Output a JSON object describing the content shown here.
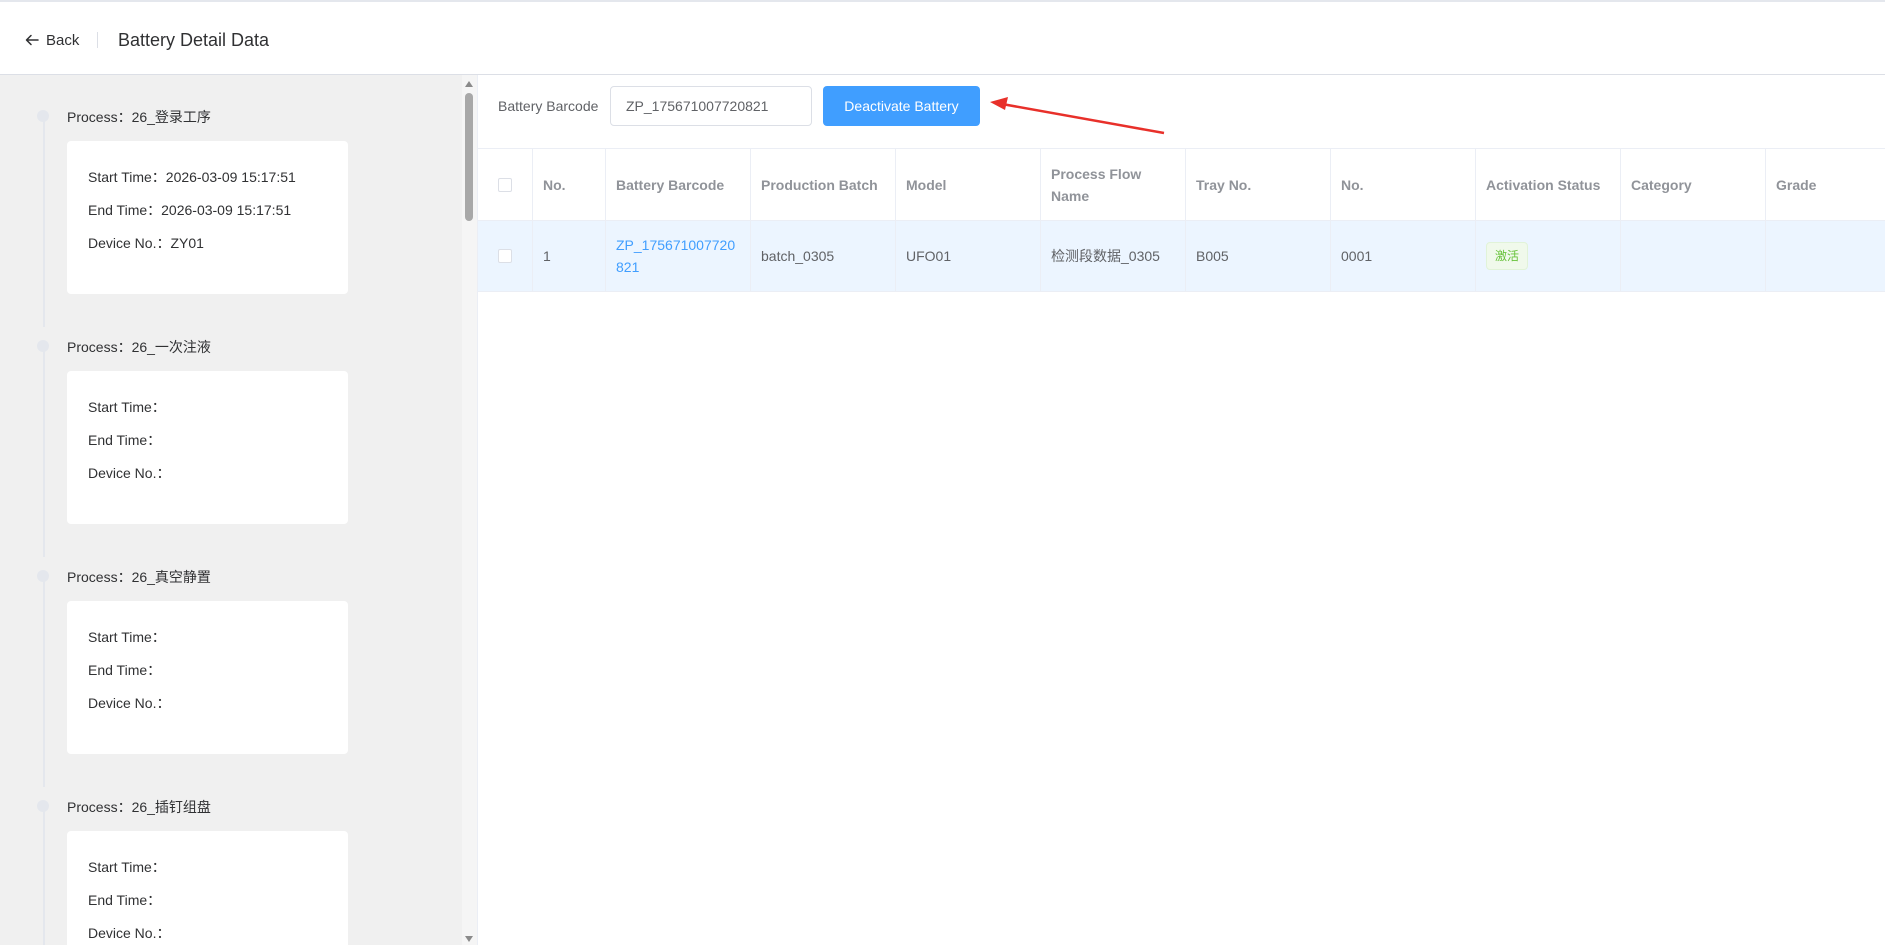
{
  "header": {
    "back_label": "Back",
    "title": "Battery Detail Data"
  },
  "processes": [
    {
      "title": "Process：26_登录工序",
      "start": "Start Time：2026-03-09 15:17:51",
      "end": "End Time：2026-03-09 15:17:51",
      "device": "Device No.：ZY01"
    },
    {
      "title": "Process：26_一次注液",
      "start": "Start Time：",
      "end": "End Time：",
      "device": "Device No.："
    },
    {
      "title": "Process：26_真空静置",
      "start": "Start Time：",
      "end": "End Time：",
      "device": "Device No.："
    },
    {
      "title": "Process：26_插钉组盘",
      "start": "Start Time：",
      "end": "End Time：",
      "device": "Device No.："
    }
  ],
  "search": {
    "label": "Battery Barcode",
    "value": "ZP_175671007720821",
    "deactivate_label": "Deactivate Battery"
  },
  "table": {
    "columns": [
      "No.",
      "Battery Barcode",
      "Production Batch",
      "Model",
      "Process Flow Name",
      "Tray No.",
      "No.",
      "Activation Status",
      "Category",
      "Grade"
    ],
    "rows": [
      {
        "no": "1",
        "barcode": "ZP_175671007720821",
        "batch": "batch_0305",
        "model": "UFO01",
        "flow": "检测段数据_0305",
        "tray": "B005",
        "pos": "0001",
        "status": "激活",
        "category": "",
        "grade": ""
      }
    ]
  },
  "colors": {
    "primary": "#409eff",
    "arrow": "#e8302a",
    "status_green": "#67c23a",
    "row_highlight": "#ecf5ff"
  }
}
